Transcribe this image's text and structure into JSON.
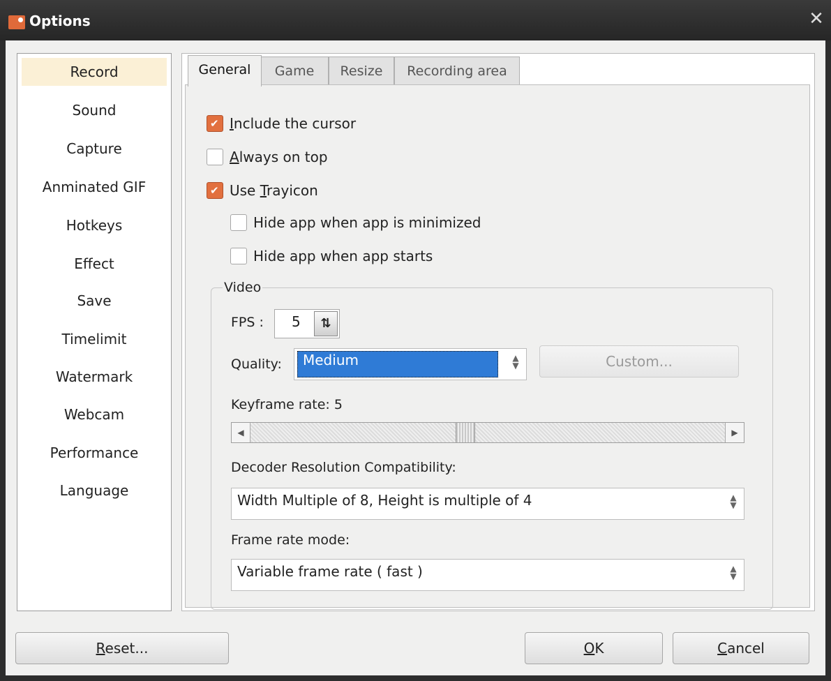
{
  "window": {
    "title": "Options",
    "close_glyph": "✕"
  },
  "sidebar": {
    "selected": "Record",
    "items": [
      {
        "label": "Record"
      },
      {
        "label": "Sound"
      },
      {
        "label": "Capture"
      },
      {
        "label": "Anminated GIF"
      },
      {
        "label": "Hotkeys"
      },
      {
        "label": "Effect"
      },
      {
        "label": "Save"
      },
      {
        "label": "Timelimit"
      },
      {
        "label": "Watermark"
      },
      {
        "label": "Webcam"
      },
      {
        "label": "Performance"
      },
      {
        "label": "Language"
      }
    ]
  },
  "tabs": [
    {
      "label": "General",
      "active": true
    },
    {
      "label": "Game"
    },
    {
      "label": "Resize"
    },
    {
      "label": "Recording area"
    }
  ],
  "general": {
    "include_cursor": {
      "pre": "",
      "u": "I",
      "post": "nclude the cursor",
      "checked": true
    },
    "always_on_top": {
      "pre": "",
      "u": "A",
      "post": "lways on top",
      "checked": false
    },
    "use_trayicon": {
      "pre": "Use ",
      "u": "T",
      "post": "rayicon",
      "checked": true
    },
    "hide_minimized": {
      "label": "Hide app when app is minimized",
      "checked": false
    },
    "hide_starts": {
      "label": "Hide app when app starts",
      "checked": false
    }
  },
  "video": {
    "group_title": "Video",
    "fps_label": "FPS :",
    "fps_value": "5",
    "quality_label": "Quality:",
    "quality_value": "Medium",
    "custom_button": "Custom...",
    "keyframe_label": "Keyframe rate: 5",
    "keyframe_fraction": 0.45,
    "decoder_label": "Decoder Resolution Compatibility:",
    "decoder_value": "Width Multiple of 8, Height is multiple of 4",
    "frame_rate_label": "Frame rate mode:",
    "frame_rate_value": "Variable frame rate ( fast )"
  },
  "footer": {
    "reset": {
      "pre": "",
      "u": "R",
      "post": "eset..."
    },
    "ok": {
      "pre": "",
      "u": "O",
      "post": "K"
    },
    "cancel": {
      "pre": "",
      "u": "C",
      "post": "ancel"
    }
  },
  "colors": {
    "accent": "#e2703f",
    "selection": "#2f7bd6",
    "nav_selected": "#fbf0d6"
  },
  "icons": {
    "app": "recorder-app-icon",
    "spin": "up-down-arrows-icon"
  }
}
